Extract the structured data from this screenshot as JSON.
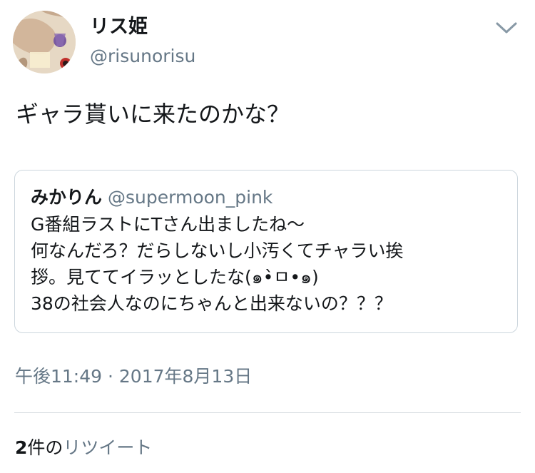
{
  "user": {
    "display_name": "リス姫",
    "handle": "@risunorisu",
    "avatar_icon": "profile-avatar"
  },
  "tweet": {
    "text": "ギャラ貰いに来たのかな？"
  },
  "quoted": {
    "display_name": "みかりん",
    "handle": "@supermoon_pink",
    "lines": [
      "G番組ラストにTさん出ましたね〜",
      "何なんだろ？だらしないし小汚くてチャラい挨",
      "拶。見ててイラッとしたな(๑•̀ㅁ•๑)",
      "38の社会人なのにちゃんと出来ないの？？？"
    ]
  },
  "meta": {
    "timestamp": "午後11:49 · 2017年8月13日"
  },
  "stats": {
    "count": "2",
    "unit": "件の",
    "label": "リツイート"
  },
  "icons": {
    "menu": "chevron-down-icon"
  },
  "colors": {
    "primary_text": "#14171a",
    "secondary_text": "#657786",
    "border": "#ccd6dd"
  }
}
